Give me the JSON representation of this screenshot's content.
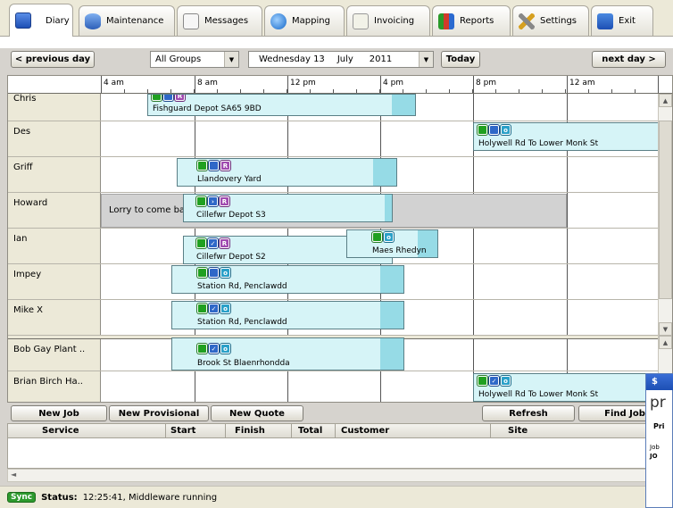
{
  "tabs": [
    {
      "label": "Diary",
      "icon": "diary-icon"
    },
    {
      "label": "Maintenance",
      "icon": "database-icon"
    },
    {
      "label": "Messages",
      "icon": "mail-icon"
    },
    {
      "label": "Mapping",
      "icon": "globe-icon"
    },
    {
      "label": "Invoicing",
      "icon": "invoice-icon"
    },
    {
      "label": "Reports",
      "icon": "chart-icon"
    },
    {
      "label": "Settings",
      "icon": "tools-icon"
    },
    {
      "label": "Exit",
      "icon": "exit-icon"
    }
  ],
  "toolbar": {
    "prev_day": "< previous day",
    "group_value": "All Groups",
    "date_day": "Wednesday 13",
    "date_month": "July",
    "date_year": "2011",
    "today": "Today",
    "next_day": "next day >"
  },
  "timeline": {
    "labels": [
      "4 am",
      "8 am",
      "12 pm",
      "4 pm",
      "8 pm",
      "12 am"
    ]
  },
  "rows": [
    {
      "name": "Chris",
      "note": "",
      "jobs": [
        {
          "label": "Fishguard Depot SA65 9BD"
        }
      ]
    },
    {
      "name": "Des",
      "note": "",
      "jobs": [
        {
          "label": "Holywell Rd To Lower Monk St"
        }
      ]
    },
    {
      "name": "Griff",
      "note": "",
      "jobs": [
        {
          "label": "Llandovery Yard"
        }
      ]
    },
    {
      "name": "Howard",
      "note": "Lorry to come back",
      "jobs": [
        {
          "label": "Cillefwr Depot S3"
        }
      ]
    },
    {
      "name": "Ian",
      "note": "",
      "jobs": [
        {
          "label": "Cillefwr Depot S2"
        },
        {
          "label": "Maes Rhedyn"
        }
      ]
    },
    {
      "name": "Impey",
      "note": "",
      "jobs": [
        {
          "label": "Station Rd, Penclawdd"
        }
      ]
    },
    {
      "name": "Mike X",
      "note": "",
      "jobs": [
        {
          "label": "Station Rd, Penclawdd"
        }
      ]
    },
    {
      "name": "Bob Gay Plant ..",
      "note": "",
      "jobs": [
        {
          "label": "Brook St Blaenrhondda"
        }
      ]
    },
    {
      "name": "Brian Birch Ha..",
      "note": "",
      "jobs": [
        {
          "label": "Holywell Rd To Lower Monk St"
        }
      ]
    }
  ],
  "actions": {
    "new_job": "New Job",
    "new_provisional": "New Provisional",
    "new_quote": "New Quote",
    "refresh": "Refresh",
    "find_job": "Find Job"
  },
  "list_columns": [
    "Service",
    "Start",
    "Finish",
    "Total",
    "Customer",
    "Site"
  ],
  "status": {
    "badge": "Sync",
    "label": "Status:",
    "text": "12:25:41, Middleware running"
  },
  "popup": {
    "title_icon": "app-icon",
    "heading": "pr",
    "tab": "Pri",
    "col": "Job",
    "val": "JO"
  }
}
